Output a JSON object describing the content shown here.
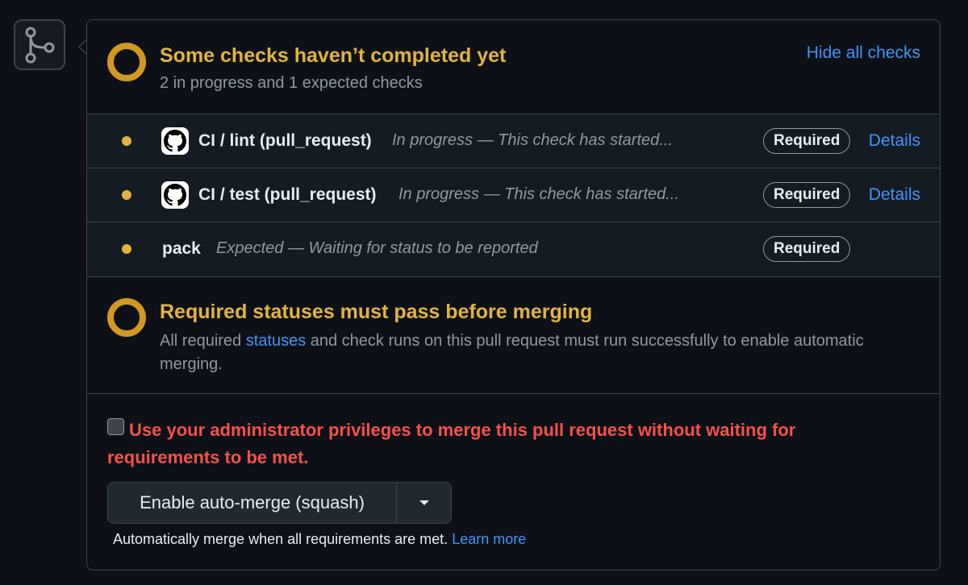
{
  "header": {
    "title": "Some checks haven’t completed yet",
    "subtitle": "2 in progress and 1 expected checks",
    "hide_label": "Hide all checks"
  },
  "checks": [
    {
      "name": "CI / lint (pull_request)",
      "description": "In progress — This check has started...",
      "badge": "Required",
      "details": "Details",
      "icon": "github-icon"
    },
    {
      "name": "CI / test (pull_request)",
      "description": "In progress — This check has started...",
      "badge": "Required",
      "details": "Details",
      "icon": "github-icon"
    },
    {
      "name": "pack",
      "description": "Expected — Waiting for status to be reported",
      "badge": "Required"
    }
  ],
  "required_statuses": {
    "title": "Required statuses must pass before merging",
    "desc_before": "All required ",
    "desc_link": "statuses",
    "desc_after": " and check runs on this pull request must run successfully to enable automatic merging."
  },
  "merge": {
    "admin_label": "Use your administrator privileges to merge this pull request without waiting for requirements to be met.",
    "button_label": "Enable auto-merge (squash)",
    "note": "Automatically merge when all requirements are met.",
    "learn_more": "Learn more"
  },
  "colors": {
    "pending": "#d29922",
    "title_yellow": "#e3b341",
    "link": "#4493f8",
    "danger": "#f85149"
  }
}
